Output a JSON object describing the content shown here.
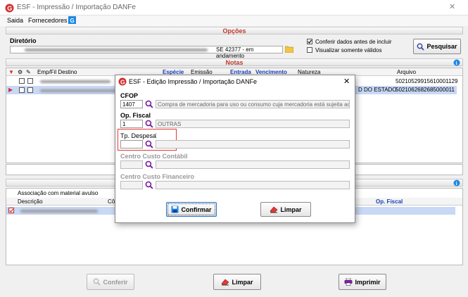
{
  "window": {
    "title": "ESF - Impressão / Importação DANFe"
  },
  "menu": {
    "items": [
      "Saida",
      "Fornecedores"
    ]
  },
  "opcoes": {
    "header": "Opções",
    "diretorio_label": "Diretório",
    "diretorio_value": "SE 42377 - em andamento",
    "conferir_label": "Conferir dados antes de incluir",
    "conferir_checked": true,
    "visualizar_label": "Visualizar somente válidos",
    "visualizar_checked": false,
    "pesquisar_label": "Pesquisar"
  },
  "notas": {
    "header": "Notas",
    "columns": [
      "Emp/Fil Destino",
      "Espécie",
      "Emissão",
      "Entrada",
      "Vencimento",
      "Natureza",
      "Arquivo"
    ],
    "rows": [
      {
        "cells": [
          "",
          "",
          "",
          "",
          "",
          "",
          "50210529915610001129"
        ]
      },
      {
        "cells": [
          "",
          "",
          "",
          "",
          "",
          "D DO ESTADO",
          "5021062682685000011"
        ]
      }
    ]
  },
  "itens": {
    "assoc_label": "Associação com material avulso",
    "columns": [
      "Descrição",
      "Cô",
      "Op. Fiscal"
    ]
  },
  "footer": {
    "conferir_label": "Conferir",
    "limpar_label": "Limpar",
    "imprimir_label": "Imprimir"
  },
  "dialog": {
    "title": "ESF - Edição Impressão / Importação DANFe",
    "cfop_label": "CFOP",
    "cfop_value": "1407",
    "cfop_desc": "Compra de mercadoria para uso ou consumo cuja mercadoria está sujeita ao regi",
    "opfiscal_label": "Op. Fiscal",
    "opfiscal_value": "1",
    "opfiscal_desc": "OUTRAS",
    "tpdespesa_label": "Tp. Despesa",
    "ccc_label": "Centro Custo Contábil",
    "ccf_label": "Centro Custo Financeiro",
    "confirmar_label": "Confirmar",
    "limpar_label": "Limpar"
  },
  "colors": {
    "accent": "#c0392b",
    "selection": "#c8d8f5",
    "highlight": "#e53935"
  }
}
